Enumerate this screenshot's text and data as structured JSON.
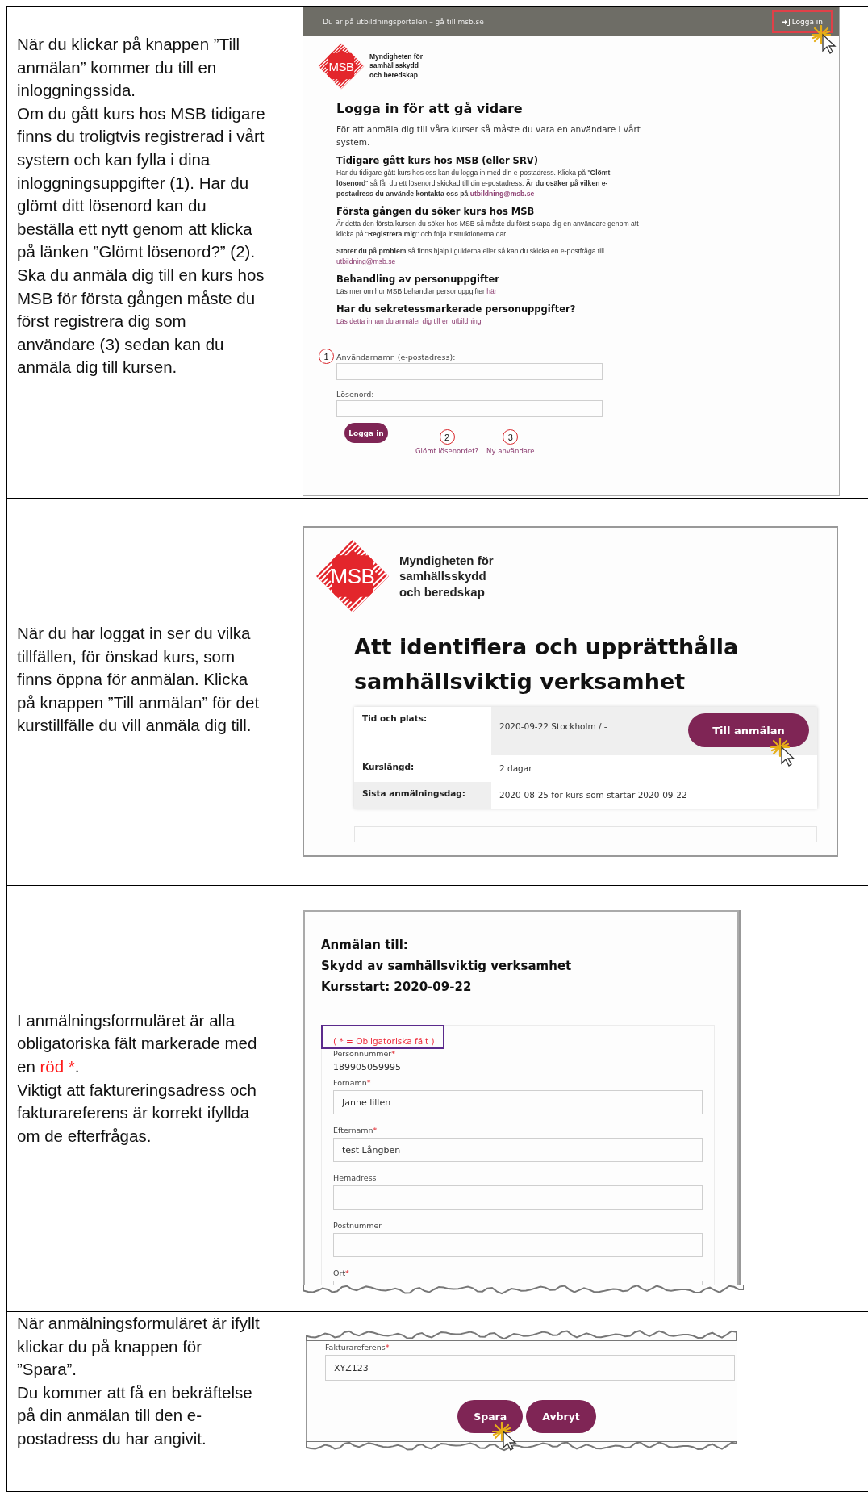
{
  "rows": [
    {
      "kind": "login",
      "instruction": [
        {
          "text": "När du klickar på knappen ”Till anmälan” kommer du till en inloggningssida."
        },
        {
          "text": "Om du gått kurs hos MSB tidigare finns du troligtvis registrerad i vårt system och kan fylla i dina inloggningsuppgifter (1). Har du glömt ditt lösenord kan du beställa ett nytt genom att klicka på länken ”Glömt lösenord?” (2)."
        },
        {
          "text": "Ska du anmäla dig till en kurs hos MSB för första gången måste du först registrera dig som användare (3) sedan kan du anmäla dig till kursen."
        }
      ],
      "screen": {
        "top_bar": {
          "text": "Du är på utbildningsportalen – gå till msb.se",
          "login": {
            "label": "Logga in",
            "highlighted": true,
            "clicked": true
          }
        },
        "logo": {
          "mark": "MSB",
          "lines": [
            "Myndigheten för",
            "samhällsskydd",
            "och beredskap"
          ]
        },
        "title": "Logga in för att gå vidare",
        "intro": "För att anmäla dig till våra kurser så måste du vara en användare i vårt system.",
        "sections": [
          {
            "heading": "Tidigare gått kurs hos MSB (eller SRV)",
            "paragraphs": [
              {
                "text": "Har du tidigare gått kurs hos oss kan du logga in med din e-postadress. Klicka på \"**Glömt lösenord**\" så får du ett lösenord skickad till din e-postadress. **Är du osäker på vilken e-postadress du använde kontakta oss på**",
                "link": {
                  "text": "utbildning@msb.se",
                  "bold": true
                }
              }
            ]
          },
          {
            "heading": "Första gången du söker kurs hos MSB",
            "paragraphs": [
              {
                "text": "Är detta den första kursen du söker hos MSB så måste du först skapa dig en användare genom att klicka på \"**Registrera mig**\" och följa instruktionerna där."
              },
              {
                "text": "**Stöter du på problem** så finns hjälp i guiderna eller så kan du skicka en e-postfråga till",
                "link": {
                  "text": "utbildning@msb.se",
                  "bold": false
                }
              }
            ]
          },
          {
            "heading": "Behandling av personuppgifter",
            "paragraphs": [
              {
                "text": "Läs mer om hur MSB behandlar personuppgifter",
                "link": {
                  "text": "här",
                  "bold": false
                }
              }
            ]
          },
          {
            "heading": "Har du sekretessmarkerade personuppgifter?",
            "paragraphs": [
              {
                "link": {
                  "text": "Läs detta innan du anmäler dig till en utbildning",
                  "bold": false
                }
              }
            ]
          }
        ],
        "fields": [
          {
            "marker": "1",
            "label": "Användarnamn (e-postadress):"
          },
          {
            "label": "Lösenord:"
          }
        ],
        "button": "Logga in",
        "links": [
          {
            "marker": "2",
            "text": "Glömt lösenordet?"
          },
          {
            "marker": "3",
            "text": "Ny användare"
          }
        ]
      }
    },
    {
      "kind": "course",
      "instruction": [
        {
          "text": "När du har loggat in ser du vilka tillfällen, för önskad kurs, som finns öppna för anmälan. Klicka på knappen ”Till anmälan” för det kurstillfälle du vill anmäla dig till."
        }
      ],
      "screen": {
        "logo": {
          "mark": "MSB",
          "lines": [
            "Myndigheten för",
            "samhällsskydd",
            "och beredskap"
          ]
        },
        "title": "Att identifiera och upprätthålla samhällsviktig verksamhet",
        "details": [
          {
            "label": "Tid och plats:",
            "value": "2020-09-22 Stockholm / -",
            "button": {
              "label": "Till anmälan",
              "clicked": true
            }
          },
          {
            "label": "Kurslängd:",
            "value": "2 dagar"
          },
          {
            "label": "Sista anmälningsdag:",
            "value": "2020-08-25 för kurs som startar 2020-09-22"
          }
        ]
      }
    },
    {
      "kind": "form",
      "instruction": [
        {
          "text": "I anmälningsformuläret är alla obligatoriska fält markerade med en ",
          "highlight": "röd *",
          "after": "."
        },
        {
          "text": "Viktigt att faktureringsadress och fakturareferens är korrekt ifyllda om de efterfrågas."
        }
      ],
      "screen": {
        "headings": [
          "Anmälan till:",
          "Skydd av samhällsviktig verksamhet",
          "Kursstart: 2020-09-22"
        ],
        "required_note": {
          "text": "( * = Obligatoriska fält )",
          "highlighted": true
        },
        "required_mark": "*",
        "fields": [
          {
            "kind": "static",
            "label": "Personnummer",
            "required": true,
            "value": "189905059995"
          },
          {
            "kind": "input",
            "label": "Förnamn",
            "required": true,
            "value": "Janne lillen"
          },
          {
            "kind": "input",
            "label": "Efternamn",
            "required": true,
            "value": "test Långben"
          },
          {
            "kind": "input",
            "label": "Hemadress",
            "required": false
          },
          {
            "kind": "input",
            "label": "Postnummer",
            "required": false
          },
          {
            "kind": "cut",
            "label": "Ort",
            "required": true
          }
        ]
      }
    },
    {
      "kind": "save",
      "instruction": [
        {
          "text": "När anmälningsformuläret är ifyllt klickar du på knappen för ”Spara”."
        },
        {
          "text": "Du kommer att få en bekräftelse på din anmälan till den e-postadress du har angivit."
        }
      ],
      "screen": {
        "required_mark": "*",
        "fields": [
          {
            "kind": "input",
            "label": "Fakturareferens",
            "required": true,
            "value": "XYZ123"
          }
        ],
        "buttons": [
          {
            "label": "Spara",
            "clicked": true
          },
          {
            "label": "Avbryt",
            "clicked": false
          }
        ]
      }
    }
  ]
}
